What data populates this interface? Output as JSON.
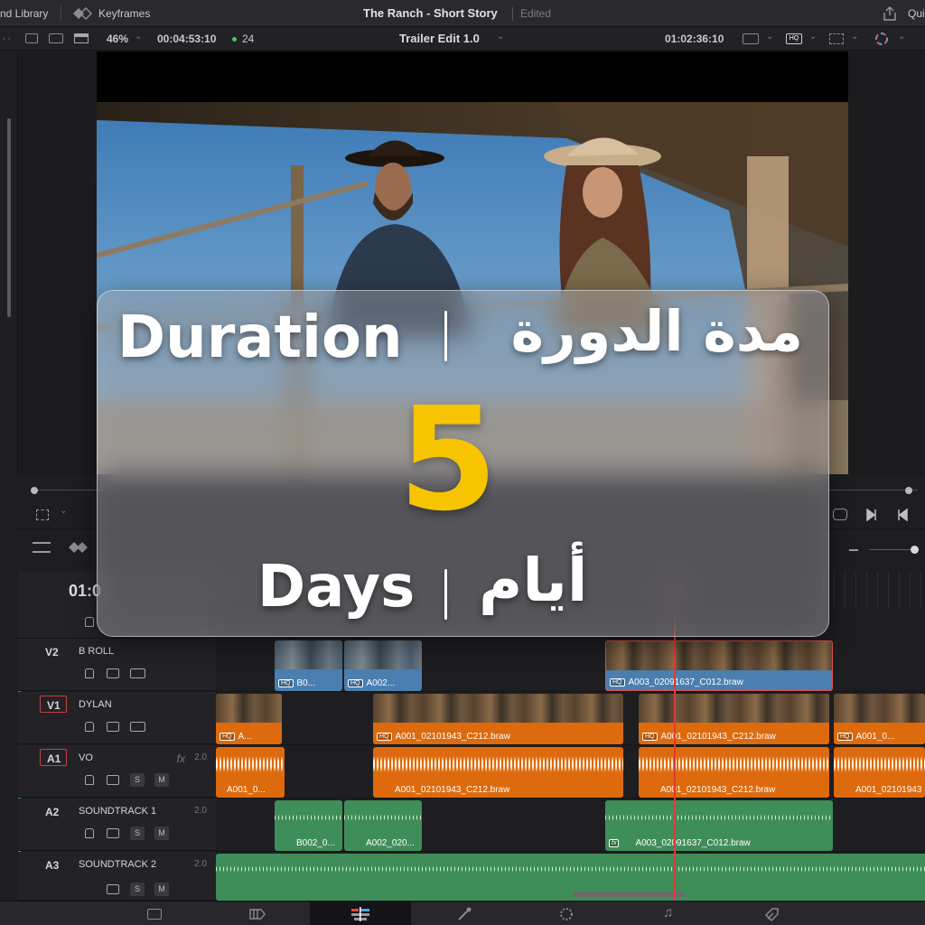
{
  "topbar": {
    "left_partial_label": "nd Library",
    "keyframes_label": "Keyframes",
    "project_title": "The Ranch - Short Story",
    "project_status": "Edited",
    "right_partial_label": "Qui"
  },
  "toolbar": {
    "zoom": "46%",
    "source_timecode": "00:04:53:10",
    "fps": "24",
    "timeline_name": "Trailer Edit 1.0",
    "record_timecode": "01:02:36:10",
    "hq_badge": "HQ"
  },
  "timeline": {
    "ruler_partial": "01:0",
    "tracks": [
      {
        "id": "V2",
        "name": "B ROLL",
        "level": ""
      },
      {
        "id": "V1",
        "name": "DYLAN",
        "level": ""
      },
      {
        "id": "A1",
        "name": "VO",
        "level": "2.0",
        "fx": "fx"
      },
      {
        "id": "A2",
        "name": "SOUNDTRACK 1",
        "level": "2.0"
      },
      {
        "id": "A3",
        "name": "SOUNDTRACK 2",
        "level": "2.0"
      }
    ],
    "solo_label": "S",
    "mute_label": "M",
    "hq_label": "HQ",
    "fx_clip_label": "fx",
    "clips": {
      "v2_1": "B0...",
      "v2_2": "A002...",
      "v2_3": "A003_02091637_C012.braw",
      "v1_1": "A...",
      "v1_2": "A001_02101943_C212.braw",
      "v1_3": "A001_02101943_C212.braw",
      "v1_4": "A001_0...",
      "a1_1": "A001_0...",
      "a1_2": "A001_02101943_C212.braw",
      "a1_3": "A001_02101943_C212.braw",
      "a1_4": "A001_02101943",
      "a2_1": "B002_0...",
      "a2_2": "A002_020...",
      "a2_3": "A003_02091637_C012.braw"
    }
  },
  "overlay": {
    "label_en": "Duration",
    "label_ar": "مدة الدورة",
    "number": "5",
    "unit_en": "Days",
    "unit_ar": "أيام"
  },
  "colors": {
    "accent_yellow": "#f6c400",
    "clip_orange": "#dd6a0d",
    "clip_blue": "#4a7fb0",
    "clip_green": "#3f8e5a",
    "playhead": "#e03a3a"
  },
  "icons": [
    "keyframes-icon",
    "share-icon",
    "chevron-down-icon",
    "lock-icon",
    "film-icon",
    "link-icon",
    "playhead-icon",
    "next-edit-icon",
    "prev-edit-icon",
    "loop-icon",
    "media-page-icon",
    "cut-page-icon",
    "edit-page-icon",
    "fusion-page-icon",
    "color-page-icon",
    "fairlight-page-icon",
    "deliver-page-icon"
  ]
}
